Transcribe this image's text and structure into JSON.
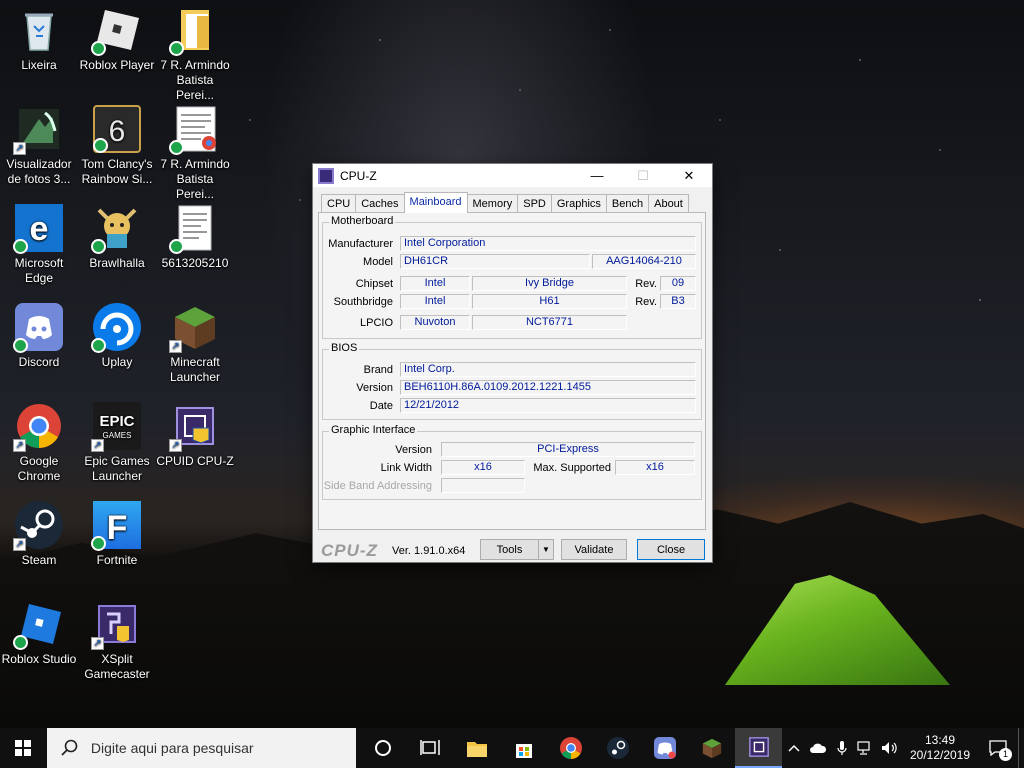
{
  "desktop": {
    "icons": [
      {
        "label": "Lixeira",
        "icon": "recycle-bin-icon"
      },
      {
        "label": "Roblox Player",
        "icon": "roblox-icon"
      },
      {
        "label": "7 R. Armindo Batista Perei...",
        "icon": "folder-icon"
      },
      {
        "label": "Visualizador de fotos 3...",
        "icon": "photo-viewer-icon"
      },
      {
        "label": "Tom Clancy's Rainbow Si...",
        "icon": "rainbow-six-icon"
      },
      {
        "label": "7 R. Armindo Batista Perei...",
        "icon": "document-icon"
      },
      {
        "label": "Microsoft Edge",
        "icon": "edge-icon"
      },
      {
        "label": "Brawlhalla",
        "icon": "brawlhalla-icon"
      },
      {
        "label": "5613205210",
        "icon": "document-icon"
      },
      {
        "label": "Discord",
        "icon": "discord-icon"
      },
      {
        "label": "Uplay",
        "icon": "uplay-icon"
      },
      {
        "label": "Minecraft Launcher",
        "icon": "minecraft-icon"
      },
      {
        "label": "Google Chrome",
        "icon": "chrome-icon"
      },
      {
        "label": "Epic Games Launcher",
        "icon": "epic-games-icon"
      },
      {
        "label": "CPUID CPU-Z",
        "icon": "cpuz-icon"
      },
      {
        "label": "Steam",
        "icon": "steam-icon"
      },
      {
        "label": "Fortnite",
        "icon": "fortnite-icon"
      },
      {
        "label": "Roblox Studio",
        "icon": "roblox-studio-icon"
      },
      {
        "label": "XSplit Gamecaster",
        "icon": "xsplit-icon"
      }
    ]
  },
  "window": {
    "title": "CPU-Z",
    "minimize": "—",
    "maximize": "☐",
    "close": "✕",
    "tabs": [
      "CPU",
      "Caches",
      "Mainboard",
      "Memory",
      "SPD",
      "Graphics",
      "Bench",
      "About"
    ],
    "active_tab": "Mainboard",
    "motherboard": {
      "group": "Motherboard",
      "manufacturer_label": "Manufacturer",
      "manufacturer": "Intel Corporation",
      "model_label": "Model",
      "model": "DH61CR",
      "model_rev": "AAG14064-210",
      "chipset_label": "Chipset",
      "chipset_vendor": "Intel",
      "chipset_name": "Ivy Bridge",
      "rev_label": "Rev.",
      "chipset_rev": "09",
      "southbridge_label": "Southbridge",
      "southbridge_vendor": "Intel",
      "southbridge_name": "H61",
      "southbridge_rev": "B3",
      "lpcio_label": "LPCIO",
      "lpcio_vendor": "Nuvoton",
      "lpcio_name": "NCT6771"
    },
    "bios": {
      "group": "BIOS",
      "brand_label": "Brand",
      "brand": "Intel Corp.",
      "version_label": "Version",
      "version": "BEH6110H.86A.0109.2012.1221.1455",
      "date_label": "Date",
      "date": "12/21/2012"
    },
    "graphic_interface": {
      "group": "Graphic Interface",
      "version_label": "Version",
      "version": "PCI-Express",
      "link_width_label": "Link Width",
      "link_width": "x16",
      "max_supported_label": "Max. Supported",
      "max_supported": "x16",
      "side_band_label": "Side Band Addressing",
      "side_band": ""
    },
    "footer": {
      "brand": "CPU-Z",
      "version": "Ver. 1.91.0.x64",
      "tools": "Tools",
      "tools_arrow": "▼",
      "validate": "Validate",
      "close": "Close"
    }
  },
  "taskbar": {
    "search_placeholder": "Digite aqui para pesquisar",
    "pinned": [
      "cortana-icon",
      "task-view-icon",
      "file-explorer-icon",
      "microsoft-store-icon",
      "chrome-icon",
      "steam-icon",
      "discord-icon",
      "minecraft-icon",
      "cpuz-icon"
    ],
    "active_app": "cpuz-icon",
    "clock_time": "13:49",
    "clock_date": "20/12/2019",
    "notification_count": "1"
  }
}
